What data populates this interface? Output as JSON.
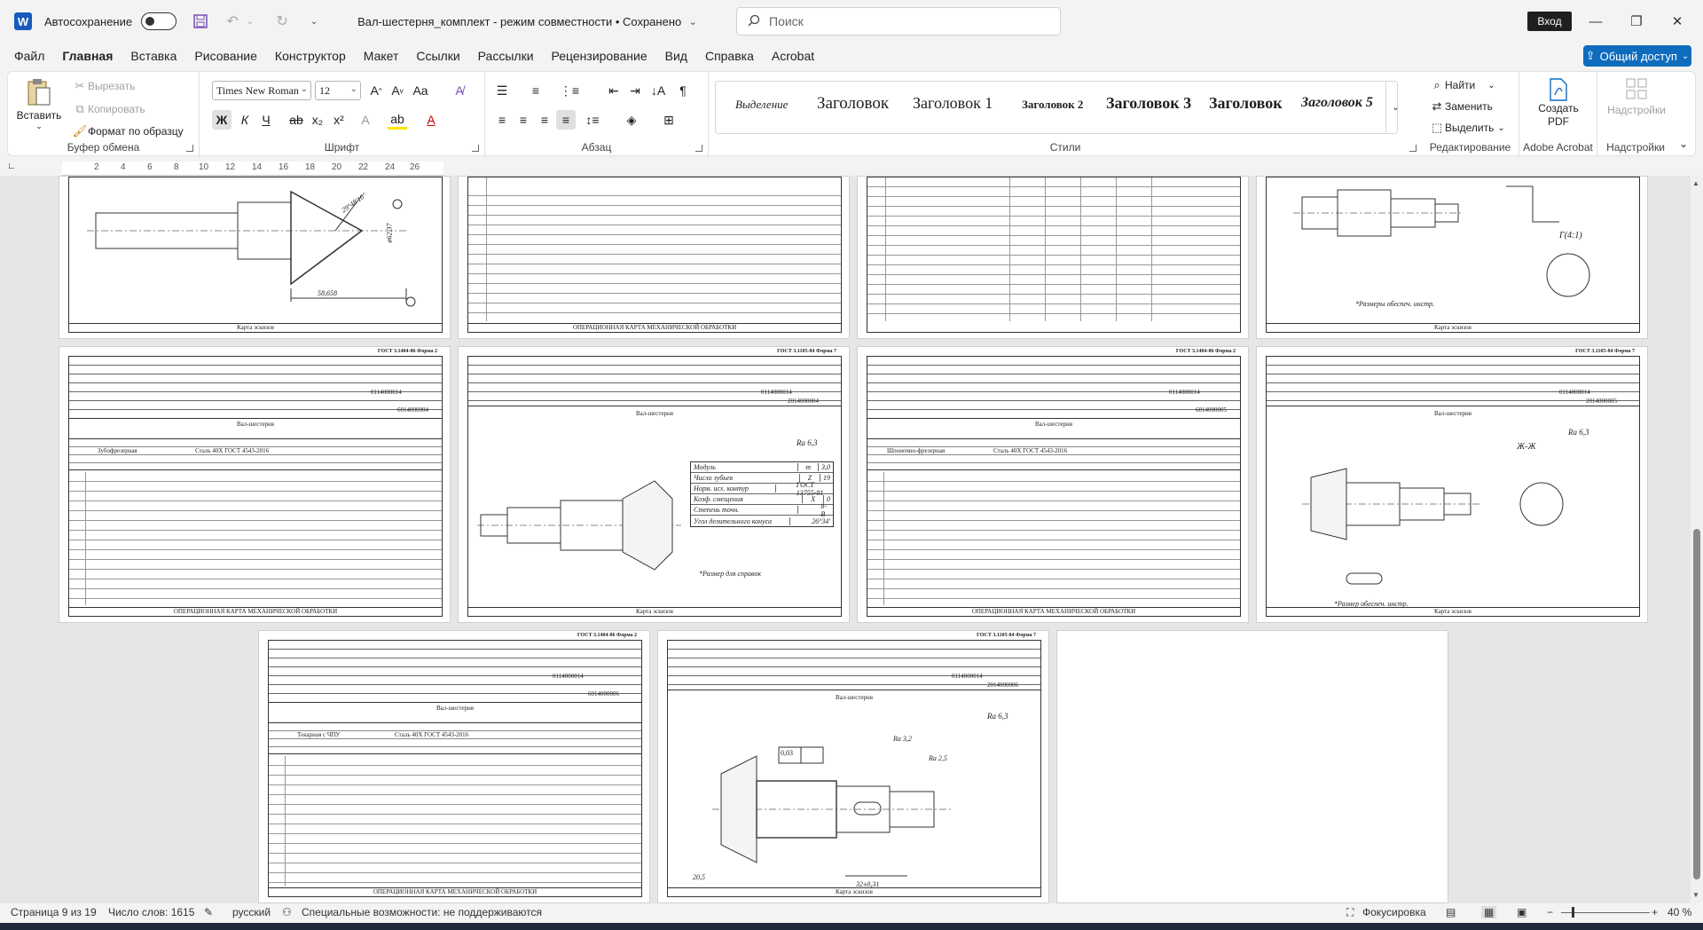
{
  "titlebar": {
    "app_letter": "W",
    "autosave_label": "Автосохранение",
    "doc_title": "Вал-шестерня_комплект  -  режим совместности  •  Сохранено",
    "search_placeholder": "Поиск",
    "signin_label": "Вход"
  },
  "menu": {
    "tabs": [
      "Файл",
      "Главная",
      "Вставка",
      "Рисование",
      "Конструктор",
      "Макет",
      "Ссылки",
      "Рассылки",
      "Рецензирование",
      "Вид",
      "Справка",
      "Acrobat"
    ],
    "active": "Главная",
    "share_label": "Общий доступ"
  },
  "ribbon": {
    "clipboard": {
      "label": "Буфер обмена",
      "paste": "Вставить",
      "cut": "Вырезать",
      "copy": "Копировать",
      "format_painter": "Формат по образцу"
    },
    "font": {
      "label": "Шрифт",
      "font_name": "Times New Roman",
      "font_size": "12"
    },
    "paragraph": {
      "label": "Абзац"
    },
    "styles": {
      "label": "Стили",
      "items": [
        "Выделение",
        "Заголовок",
        "Заголовок 1",
        "Заголовок 2",
        "Заголовок 3",
        "Заголовок",
        "Заголовок 5"
      ]
    },
    "editing": {
      "label": "Редактирование",
      "find": "Найти",
      "replace": "Заменить",
      "select": "Выделить"
    },
    "acrobat": {
      "label": "Adobe Acrobat",
      "create_pdf": "Создать PDF"
    },
    "addins": {
      "label": "Надстройки",
      "button": "Надстройки"
    }
  },
  "ruler": {
    "ticks": [
      "2",
      "4",
      "6",
      "8",
      "10",
      "12",
      "14",
      "16",
      "18",
      "20",
      "22",
      "24",
      "26"
    ]
  },
  "document": {
    "form_header_1": "ГОСТ 3.1404-86   Форма 2",
    "form_header_2": "ГОСТ 3.1105-84   Форма 7",
    "part_name": "Вал-шестерня",
    "code_1": "0114000014",
    "codes": [
      "6014000004",
      "2014000004",
      "6014000005",
      "2014000005",
      "6014000006",
      "2014000006"
    ],
    "card_operational": "ОПЕРАЦИОННАЯ КАРТА МЕХАНИЧЕСКОЙ ОБРАБОТКИ",
    "card_sketch": "Карта эскизов",
    "operations": [
      "Зубофрезерная",
      "Шпоночно-фрезерная",
      "Токарная с ЧПУ"
    ],
    "material": "Сталь 40Х ГОСТ 4543-2016",
    "gear_table": [
      [
        "Модуль",
        "m",
        "3,0"
      ],
      [
        "Число зубьев",
        "Z",
        "19"
      ],
      [
        "Норм. исх. контур",
        "",
        "ГОСТ 13755-81"
      ],
      [
        "Коэф. смещения",
        "X",
        "0"
      ],
      [
        "Степень точн.",
        "",
        "8-B"
      ],
      [
        "Угол делительного конуса",
        "",
        "26°34'"
      ]
    ],
    "note_ref": "*Размер для справок",
    "note_ensured": "*Размеры обеспеч. инстр.",
    "note_ensured_2": "*Размер обеспеч. инстр.",
    "roughness_1": "Ra 6,3",
    "roughness_2": "Ra 3,2",
    "roughness_3": "Ra 2,5",
    "tolerance": "0,03",
    "dim_1": "58,658",
    "dim_2": "ø62,37",
    "dim_3": "29°48'10\"",
    "dim_4": "32±0,31",
    "dim_5": "20,5",
    "section_view": "Ж-Ж",
    "view_label": "Г(4:1)"
  },
  "statusbar": {
    "page": "Страница 9 из 19",
    "words": "Число слов: 1615",
    "language": "русский",
    "accessibility": "Специальные возможности: не поддерживаются",
    "focus": "Фокусировка",
    "zoom": "40 %"
  }
}
